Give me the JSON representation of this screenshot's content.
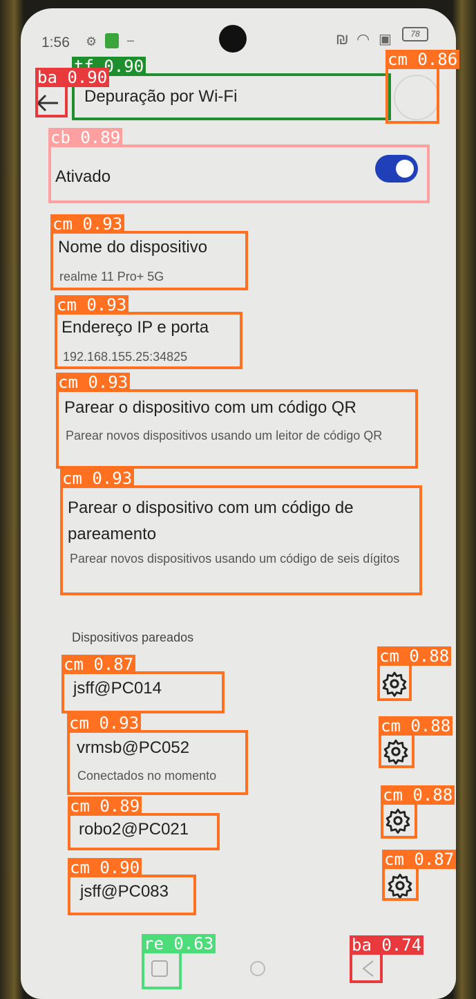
{
  "status_bar": {
    "time": "1:56",
    "battery": "78"
  },
  "header": {
    "title": "Depuração por Wi-Fi"
  },
  "toggle_row": {
    "label": "Ativado",
    "state": "on"
  },
  "settings": [
    {
      "title": "Nome do dispositivo",
      "sub": "realme 11 Pro+ 5G"
    },
    {
      "title": "Endereço IP e porta",
      "sub": "192.168.155.25:34825"
    },
    {
      "title": "Parear o dispositivo com um código QR",
      "sub": "Parear novos dispositivos usando um leitor de código QR"
    },
    {
      "title": "Parear o dispositivo com um código de pareamento",
      "sub": "Parear novos dispositivos usando um código de seis dígitos"
    }
  ],
  "paired_section": {
    "header": "Dispositivos pareados",
    "devices": [
      {
        "name": "jsff@PC014",
        "status": ""
      },
      {
        "name": "vrmsb@PC052",
        "status": "Conectados no momento"
      },
      {
        "name": "robo2@PC021",
        "status": ""
      },
      {
        "name": "jsff@PC083",
        "status": ""
      }
    ]
  },
  "colors": {
    "tf": "#1f8f2e",
    "ba": "#e8393c",
    "cm": "#ff7020",
    "cb": "#ffa0a0",
    "re": "#4ddc7a",
    "toggle": "#1f40b8"
  },
  "detections": [
    {
      "label": "tf 0.90",
      "cls": "tf"
    },
    {
      "label": "ba 0.90",
      "cls": "ba"
    },
    {
      "label": "cm 0.86",
      "cls": "cm"
    },
    {
      "label": "cb 0.89",
      "cls": "cb"
    },
    {
      "label": "cm 0.93",
      "cls": "cm"
    },
    {
      "label": "cm 0.93",
      "cls": "cm"
    },
    {
      "label": "cm 0.93",
      "cls": "cm"
    },
    {
      "label": "cm 0.93",
      "cls": "cm"
    },
    {
      "label": "cm 0.87",
      "cls": "cm"
    },
    {
      "label": "cm 0.93",
      "cls": "cm"
    },
    {
      "label": "cm 0.89",
      "cls": "cm"
    },
    {
      "label": "cm 0.90",
      "cls": "cm"
    },
    {
      "label": "cm 0.88",
      "cls": "cm"
    },
    {
      "label": "cm 0.88",
      "cls": "cm"
    },
    {
      "label": "cm 0.88",
      "cls": "cm"
    },
    {
      "label": "cm 0.87",
      "cls": "cm"
    },
    {
      "label": "re 0.63",
      "cls": "re"
    },
    {
      "label": "ba 0.74",
      "cls": "ba"
    }
  ]
}
